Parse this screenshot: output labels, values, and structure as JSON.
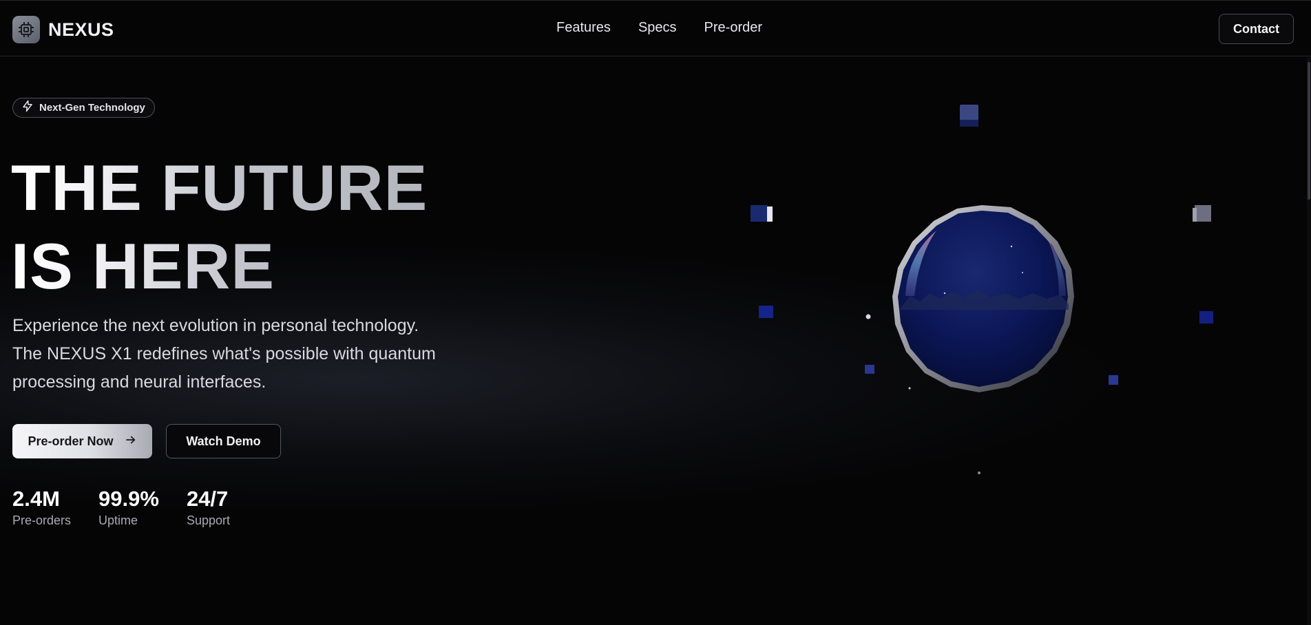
{
  "brand": {
    "name": "NEXUS",
    "logo_icon": "chip-icon"
  },
  "nav": {
    "links": [
      {
        "label": "Features"
      },
      {
        "label": "Specs"
      },
      {
        "label": "Pre-order"
      }
    ],
    "contact_label": "Contact"
  },
  "hero": {
    "badge_icon": "lightning-icon",
    "badge_label": "Next-Gen Technology",
    "headline_line1": "THE FUTURE",
    "headline_line2": "IS HERE",
    "lede_line1": "Experience the next evolution in personal technology.",
    "lede_line2": "The NEXUS X1 redefines what's possible with quantum",
    "lede_line3": "processing and neural interfaces.",
    "primary_cta": "Pre-order Now",
    "primary_cta_icon": "arrow-right-icon",
    "secondary_cta": "Watch Demo",
    "stats": [
      {
        "value": "2.4M",
        "label": "Pre-orders"
      },
      {
        "value": "99.9%",
        "label": "Uptime"
      },
      {
        "value": "24/7",
        "label": "Support"
      }
    ]
  },
  "colors": {
    "background": "#050506",
    "sphere": "#0b1757",
    "cube": "#1c2a66",
    "text_primary": "#ffffff",
    "text_muted": "#a9aab2"
  }
}
